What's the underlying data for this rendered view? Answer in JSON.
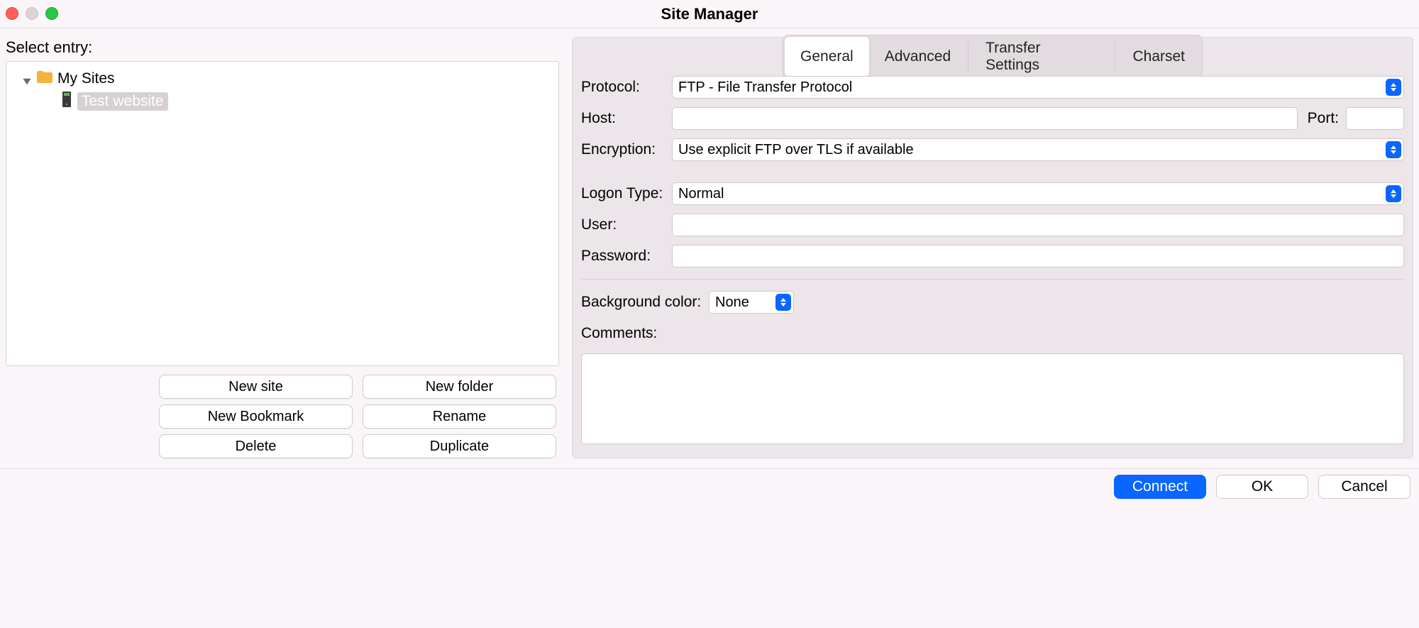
{
  "window": {
    "title": "Site Manager"
  },
  "left": {
    "select_entry_label": "Select entry:",
    "tree": {
      "root": {
        "label": "My Sites",
        "expanded": true
      },
      "items": [
        {
          "label": "Test website",
          "selected": true
        }
      ]
    },
    "buttons": {
      "new_site": "New site",
      "new_folder": "New folder",
      "new_bookmark": "New Bookmark",
      "rename": "Rename",
      "delete": "Delete",
      "duplicate": "Duplicate"
    }
  },
  "tabs": {
    "general": "General",
    "advanced": "Advanced",
    "transfer": "Transfer Settings",
    "charset": "Charset",
    "active": "general"
  },
  "form": {
    "protocol_label": "Protocol:",
    "protocol_value": "FTP - File Transfer Protocol",
    "host_label": "Host:",
    "host_value": "",
    "port_label": "Port:",
    "port_value": "",
    "encryption_label": "Encryption:",
    "encryption_value": "Use explicit FTP over TLS if available",
    "logon_label": "Logon Type:",
    "logon_value": "Normal",
    "user_label": "User:",
    "user_value": "",
    "password_label": "Password:",
    "password_value": "",
    "bgcolor_label": "Background color:",
    "bgcolor_value": "None",
    "comments_label": "Comments:",
    "comments_value": ""
  },
  "footer": {
    "connect": "Connect",
    "ok": "OK",
    "cancel": "Cancel"
  }
}
